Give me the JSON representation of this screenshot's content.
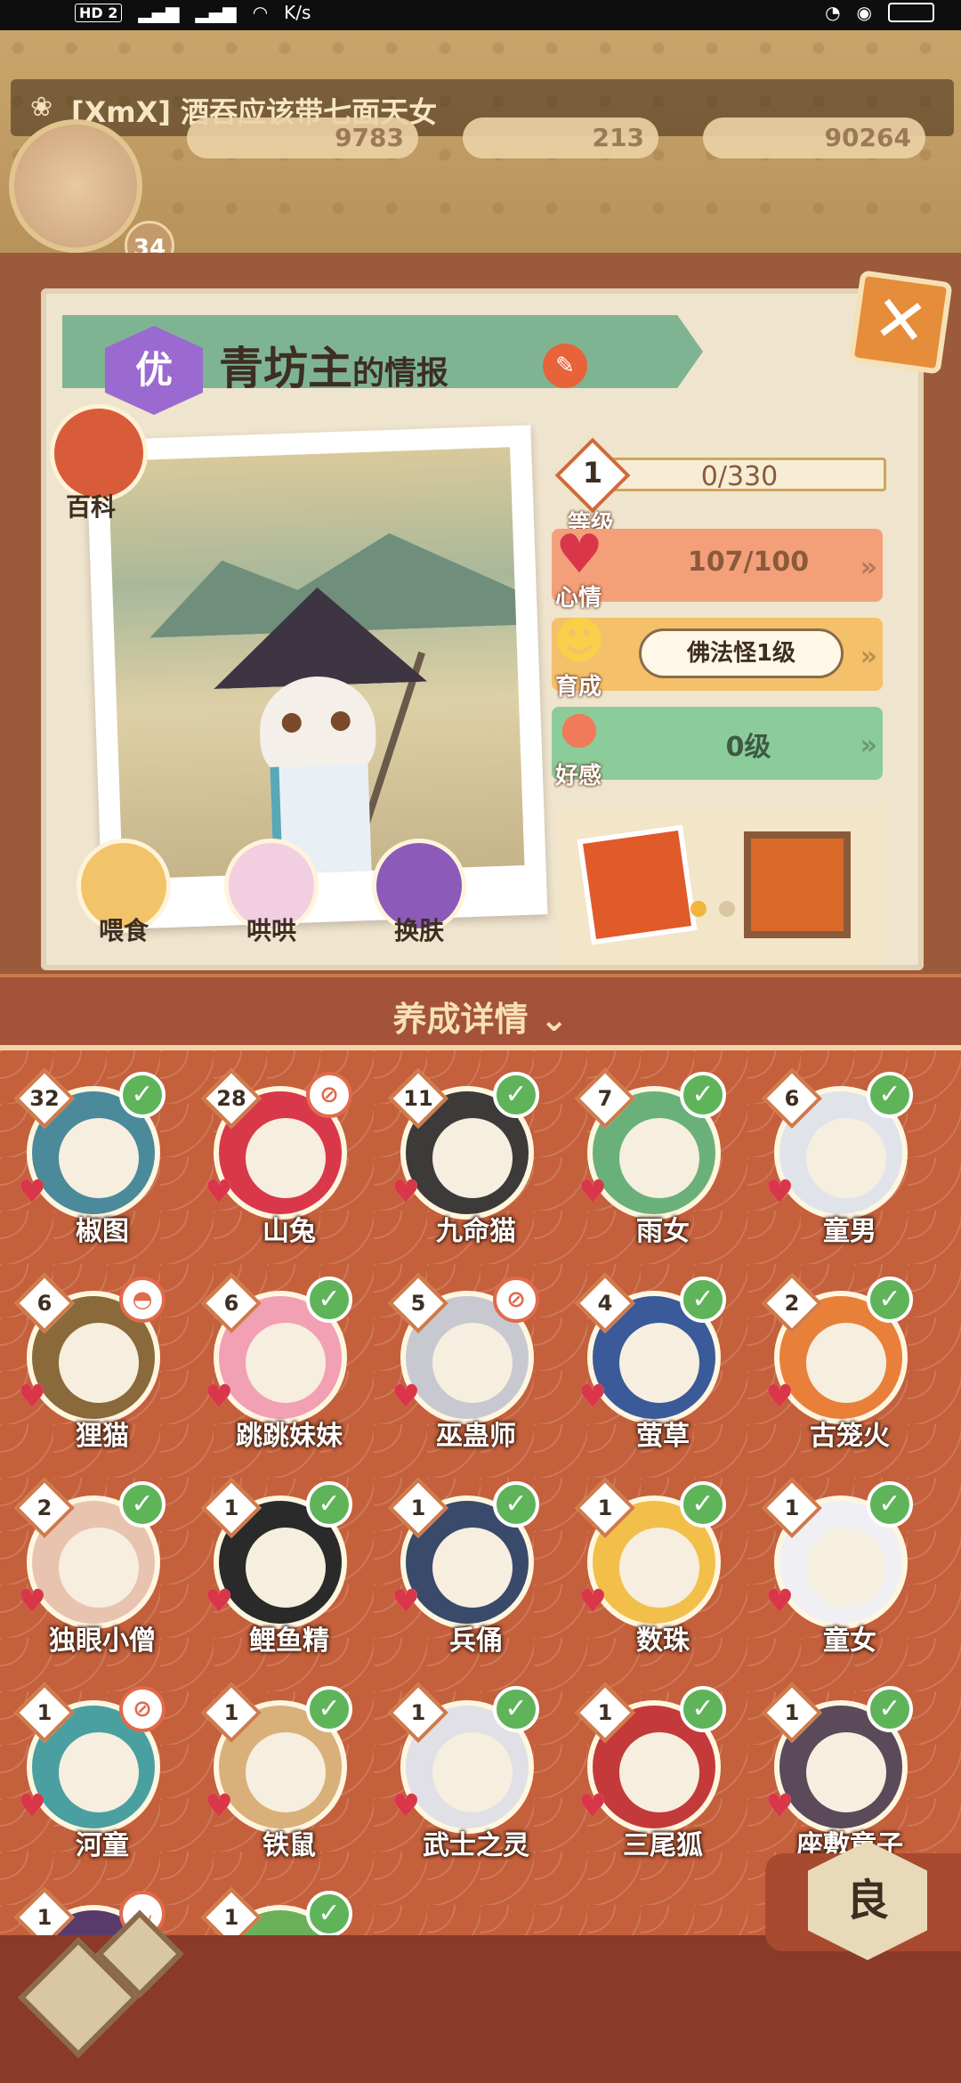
{
  "status_bar": {
    "badge": "HD 2",
    "speed": "K/s"
  },
  "header": {
    "title": "[XmX] 酒吞应该带七面天女",
    "level": "34",
    "stats": [
      "9783",
      "213",
      "90264"
    ]
  },
  "card": {
    "rank": "优",
    "name": "青坊主",
    "name_suffix": "的情报",
    "encyclopedia_label": "百科",
    "actions": [
      "喂食",
      "哄哄",
      "换肤"
    ],
    "level_number": "1",
    "level_label": "等级",
    "exp_value": "0/330",
    "mood_label": "心情",
    "mood_value": "107/100",
    "growth_label": "育成",
    "growth_value": "佛法怪1级",
    "favor_label": "好感",
    "favor_value": "0级"
  },
  "details": {
    "title": "养成详情"
  },
  "shikigami": [
    {
      "name": "椒图",
      "level": "32",
      "status": "check"
    },
    {
      "name": "山兔",
      "level": "28",
      "status": "busy"
    },
    {
      "name": "九命猫",
      "level": "11",
      "status": "check"
    },
    {
      "name": "雨女",
      "level": "7",
      "status": "check"
    },
    {
      "name": "童男",
      "level": "6",
      "status": "check"
    },
    {
      "name": "狸猫",
      "level": "6",
      "status": "bell"
    },
    {
      "name": "跳跳妹妹",
      "level": "6",
      "status": "check"
    },
    {
      "name": "巫蛊师",
      "level": "5",
      "status": "busy"
    },
    {
      "name": "萤草",
      "level": "4",
      "status": "check"
    },
    {
      "name": "古笼火",
      "level": "2",
      "status": "check"
    },
    {
      "name": "独眼小僧",
      "level": "2",
      "status": "check"
    },
    {
      "name": "鲤鱼精",
      "level": "1",
      "status": "check"
    },
    {
      "name": "兵俑",
      "level": "1",
      "status": "check"
    },
    {
      "name": "数珠",
      "level": "1",
      "status": "check"
    },
    {
      "name": "童女",
      "level": "1",
      "status": "check"
    },
    {
      "name": "河童",
      "level": "1",
      "status": "busy"
    },
    {
      "name": "铁鼠",
      "level": "1",
      "status": "check"
    },
    {
      "name": "武士之灵",
      "level": "1",
      "status": "check"
    },
    {
      "name": "三尾狐",
      "level": "1",
      "status": "check"
    },
    {
      "name": "座敷童子",
      "level": "1",
      "status": "check"
    },
    {
      "name": "",
      "level": "1",
      "status": "bowl"
    },
    {
      "name": "",
      "level": "1",
      "status": "check"
    }
  ],
  "grade_button": "良",
  "colors": {
    "accent": "#c4603c",
    "check": "#5fb45a",
    "mood": "#f3a07a",
    "growth": "#f4c06a",
    "favor": "#8ccc9a"
  }
}
